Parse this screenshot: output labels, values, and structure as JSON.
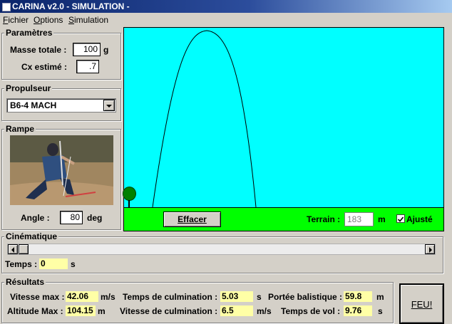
{
  "window": {
    "title": "CARINA v2.0 - SIMULATION -"
  },
  "menu": [
    "Fichier",
    "Options",
    "Simulation"
  ],
  "parametres": {
    "legend": "Paramètres",
    "masse_label": "Masse totale :",
    "masse_value": "100",
    "masse_unit": "g",
    "cx_label": "Cx estimé :",
    "cx_value": ".7"
  },
  "propulseur": {
    "legend": "Propulseur",
    "selected": "B6-4 MACH"
  },
  "rampe": {
    "legend": "Rampe",
    "photo": "rocket-launch-photo",
    "angle_label": "Angle :",
    "angle_value": "80",
    "angle_unit": "deg"
  },
  "simulation": {
    "sky_color": "#00ffff",
    "ground_color": "#00ff00",
    "effacer_label": "Effacer",
    "terrain_label": "Terrain :",
    "terrain_value": "183",
    "terrain_unit": "m",
    "ajuste_label": "Ajusté",
    "ajuste_checked": true
  },
  "cinematique": {
    "legend": "Cinématique",
    "temps_label": "Temps :",
    "temps_value": "0",
    "temps_unit": "s"
  },
  "resultats": {
    "legend": "Résultats",
    "vitesse_max_label": "Vitesse max :",
    "vitesse_max_value": "42.06",
    "vitesse_max_unit": "m/s",
    "t_culm_label": "Temps de culmination :",
    "t_culm_value": "5.03",
    "t_culm_unit": "s",
    "portee_label": "Portée balistique :",
    "portee_value": "59.8",
    "portee_unit": "m",
    "altitude_label": "Altitude Max :",
    "altitude_value": "104.15",
    "altitude_unit": "m",
    "v_culm_label": "Vitesse de culmination :",
    "v_culm_value": "6.5",
    "v_culm_unit": "m/s",
    "vol_label": "Temps de vol :",
    "vol_value": "9.76",
    "vol_unit": "s",
    "feu_label": "FEU!"
  }
}
